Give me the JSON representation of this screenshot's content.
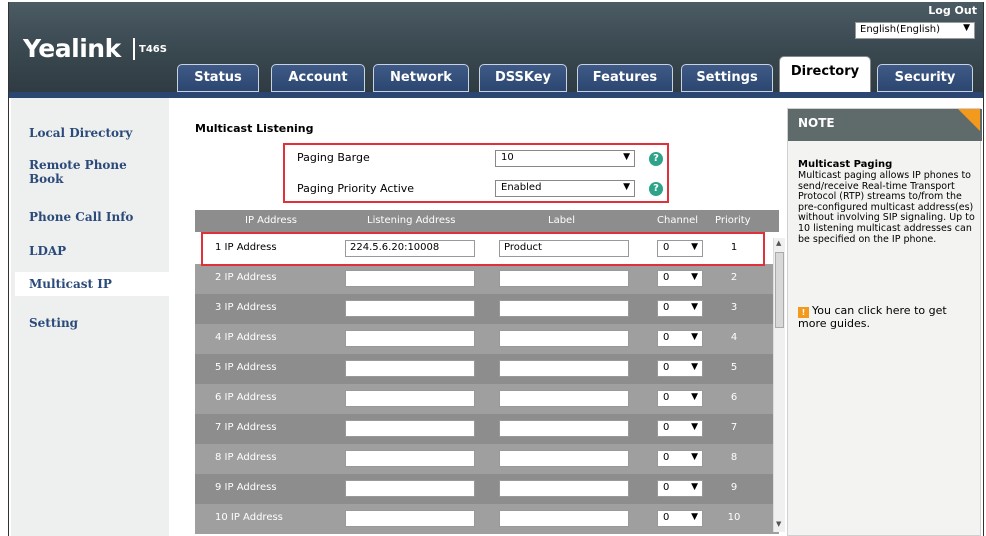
{
  "header": {
    "logo": "Yealink",
    "model": "T46S",
    "logout": "Log Out",
    "language": "English(English)"
  },
  "tabs": [
    "Status",
    "Account",
    "Network",
    "DSSKey",
    "Features",
    "Settings",
    "Directory",
    "Security"
  ],
  "active_tab": "Directory",
  "sidebar": {
    "items": [
      "Local Directory",
      "Remote Phone Book",
      "Phone Call Info",
      "LDAP",
      "Multicast IP",
      "Setting"
    ],
    "active": "Multicast IP"
  },
  "section": {
    "title": "Multicast Listening",
    "paging_barge_label": "Paging Barge",
    "paging_barge_value": "10",
    "paging_priority_label": "Paging Priority Active",
    "paging_priority_value": "Enabled"
  },
  "table": {
    "headers": [
      "IP Address",
      "Listening Address",
      "Label",
      "Channel",
      "Priority"
    ],
    "rows": [
      {
        "label": "1  IP Address",
        "address": "224.5.6.20:10008",
        "name": "Product",
        "channel": "0",
        "priority": "1"
      },
      {
        "label": "2  IP Address",
        "address": "",
        "name": "",
        "channel": "0",
        "priority": "2"
      },
      {
        "label": "3  IP Address",
        "address": "",
        "name": "",
        "channel": "0",
        "priority": "3"
      },
      {
        "label": "4  IP Address",
        "address": "",
        "name": "",
        "channel": "0",
        "priority": "4"
      },
      {
        "label": "5  IP Address",
        "address": "",
        "name": "",
        "channel": "0",
        "priority": "5"
      },
      {
        "label": "6  IP Address",
        "address": "",
        "name": "",
        "channel": "0",
        "priority": "6"
      },
      {
        "label": "7  IP Address",
        "address": "",
        "name": "",
        "channel": "0",
        "priority": "7"
      },
      {
        "label": "8  IP Address",
        "address": "",
        "name": "",
        "channel": "0",
        "priority": "8"
      },
      {
        "label": "9  IP Address",
        "address": "",
        "name": "",
        "channel": "0",
        "priority": "9"
      },
      {
        "label": "10  IP Address",
        "address": "",
        "name": "",
        "channel": "0",
        "priority": "10"
      }
    ]
  },
  "note": {
    "heading": "NOTE",
    "title": "Multicast Paging",
    "text": "Multicast paging allows IP phones to send/receive Real-time Transport Protocol (RTP) streams to/from the pre-configured multicast address(es) without involving SIP signaling. Up to 10 listening multicast addresses can be specified on the IP phone.",
    "guide": "You can click here to get more guides."
  },
  "colors": {
    "nav_blue": "#2b4670",
    "highlight_red": "#e0313a",
    "help_green": "#2ea38a",
    "note_orange": "#f39a1d"
  },
  "icons": [
    "help-icon",
    "guide-icon",
    "chevron-down-icon"
  ]
}
